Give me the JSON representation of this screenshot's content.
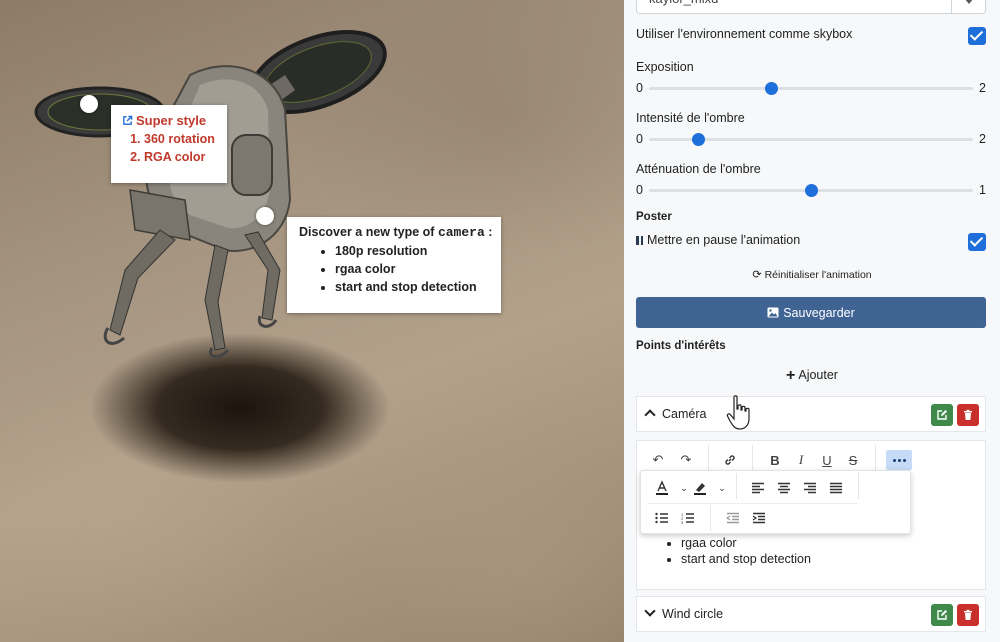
{
  "viewer": {
    "tooltip1": {
      "title": "Super style",
      "items": [
        "360 rotation",
        "RGA color"
      ]
    },
    "tooltip2": {
      "title_prefix": "Discover a new type of ",
      "title_emph": "camera",
      "title_suffix": " :",
      "items": [
        "180p resolution",
        "rgaa color",
        "start and stop detection"
      ]
    }
  },
  "panel": {
    "environment_select": {
      "value": "kaylor_mixd"
    },
    "skybox": {
      "label": "Utiliser l'environnement comme skybox",
      "checked": true
    },
    "exposure": {
      "label": "Exposition",
      "min": "0",
      "max": "2",
      "value": 0.75
    },
    "shadow_intensity": {
      "label": "Intensité de l'ombre",
      "min": "0",
      "max": "2",
      "value": 0.3
    },
    "shadow_softness": {
      "label": "Atténuation de l'ombre",
      "min": "0",
      "max": "1",
      "value": 0.5
    },
    "poster_title": "Poster",
    "pause_animation": {
      "label": "Mettre en pause l'animation",
      "checked": true
    },
    "reset_label": "Réinitialiser l'animation",
    "save_label": "Sauvegarder",
    "poi_title": "Points d'intérêts",
    "add_label": "Ajouter",
    "poi_items": [
      {
        "name": "Caméra",
        "expanded": true
      },
      {
        "name": "Wind circle",
        "expanded": false
      }
    ],
    "editor_content": [
      "rgaa color",
      "start and stop detection"
    ]
  },
  "colors": {
    "accent": "#1e6fd9",
    "save_button": "#3f6494",
    "edit_button": "#3f8a4a",
    "delete_button": "#c9302c",
    "tooltip_red": "#c0392b"
  }
}
